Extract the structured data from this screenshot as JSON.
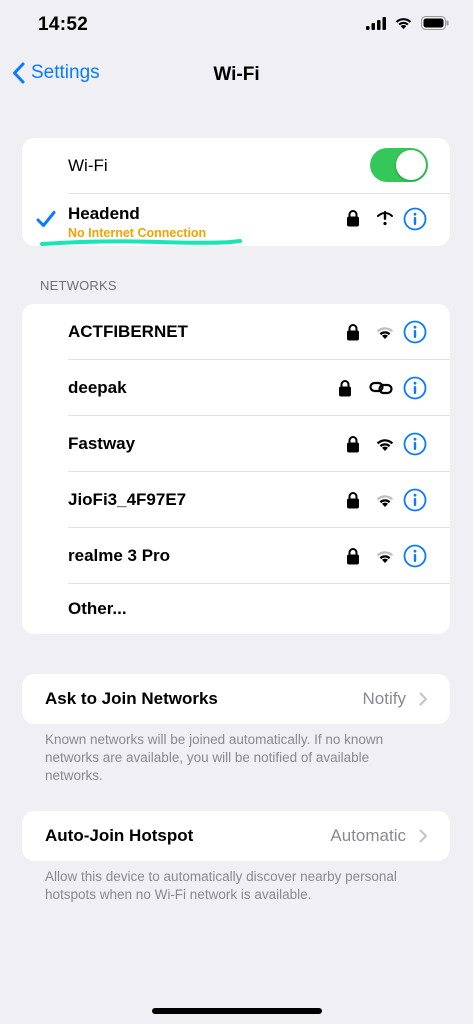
{
  "status": {
    "time": "14:52"
  },
  "nav": {
    "back_label": "Settings",
    "title": "Wi-Fi"
  },
  "wifi_toggle": {
    "label": "Wi-Fi",
    "on": true
  },
  "connected": {
    "name": "Headend",
    "status": "No Internet Connection",
    "status_color": "#f0a400"
  },
  "networks_header": "NETWORKS",
  "networks": [
    {
      "name": "ACTFIBERNET",
      "secured": true,
      "signal": "wifi-icon"
    },
    {
      "name": "deepak",
      "secured": true,
      "signal": "link-icon"
    },
    {
      "name": "Fastway",
      "secured": true,
      "signal": "wifi-icon"
    },
    {
      "name": "JioFi3_4F97E7",
      "secured": true,
      "signal": "wifi-icon"
    },
    {
      "name": "realme 3 Pro",
      "secured": true,
      "signal": "wifi-icon"
    }
  ],
  "other_label": "Other...",
  "ask_to_join": {
    "label": "Ask to Join Networks",
    "value": "Notify",
    "footer": "Known networks will be joined automatically. If no known networks are available, you will be notified of available networks."
  },
  "auto_join": {
    "label": "Auto-Join Hotspot",
    "value": "Automatic",
    "footer": "Allow this device to automatically discover nearby personal hotspots when no Wi-Fi network is available."
  },
  "colors": {
    "accent": "#0a7bff",
    "toggle_on": "#34c759",
    "highlight": "#18e6b5",
    "background": "#efeff4"
  }
}
